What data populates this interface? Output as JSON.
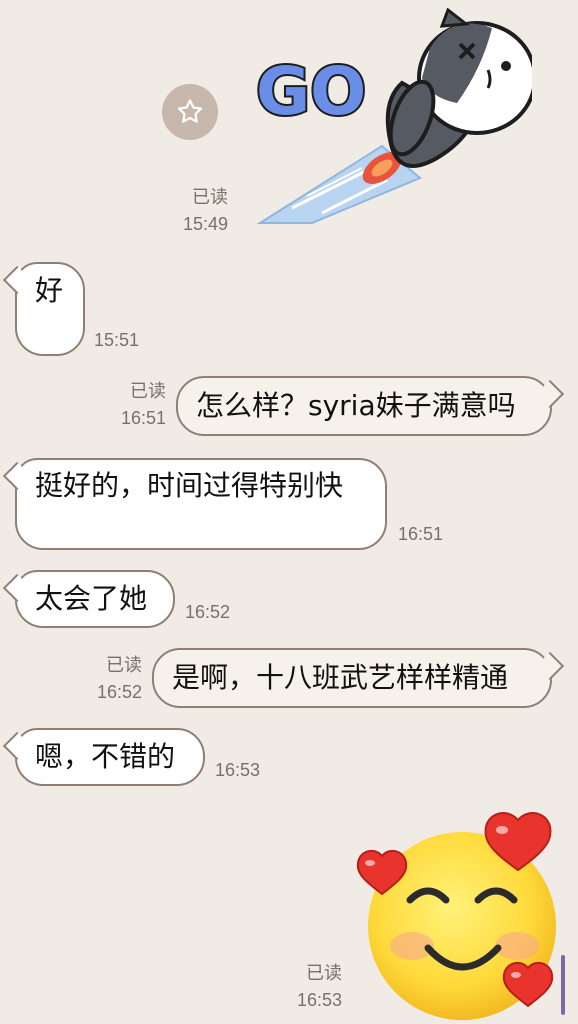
{
  "messages": {
    "sticker_go": {
      "read": "已读",
      "time": "15:49",
      "sticker_name": "cat-rocket-go-sticker",
      "sticker_text": "GO"
    },
    "m1": {
      "text": "好",
      "time": "15:51"
    },
    "m2": {
      "read": "已读",
      "time": "16:51",
      "text": "怎么样？syria妹子满意吗"
    },
    "m3": {
      "text": "挺好的，时间过得特别快",
      "time": "16:51"
    },
    "m4": {
      "text": "太会了她",
      "time": "16:52"
    },
    "m5": {
      "read": "已读",
      "time": "16:52",
      "text": "是啊，十八班武艺样样精通"
    },
    "m6": {
      "text": "嗯，不错的",
      "time": "16:53"
    },
    "sticker_smile": {
      "read": "已读",
      "time": "16:53",
      "sticker_name": "smiling-face-with-hearts-sticker"
    }
  },
  "colors": {
    "background": "#f0ece5",
    "bubble_border": "#8f7f74",
    "meta_text": "#7a7067",
    "star_button": "#c8b8ab",
    "scrollbar": "#7b6aa6"
  }
}
